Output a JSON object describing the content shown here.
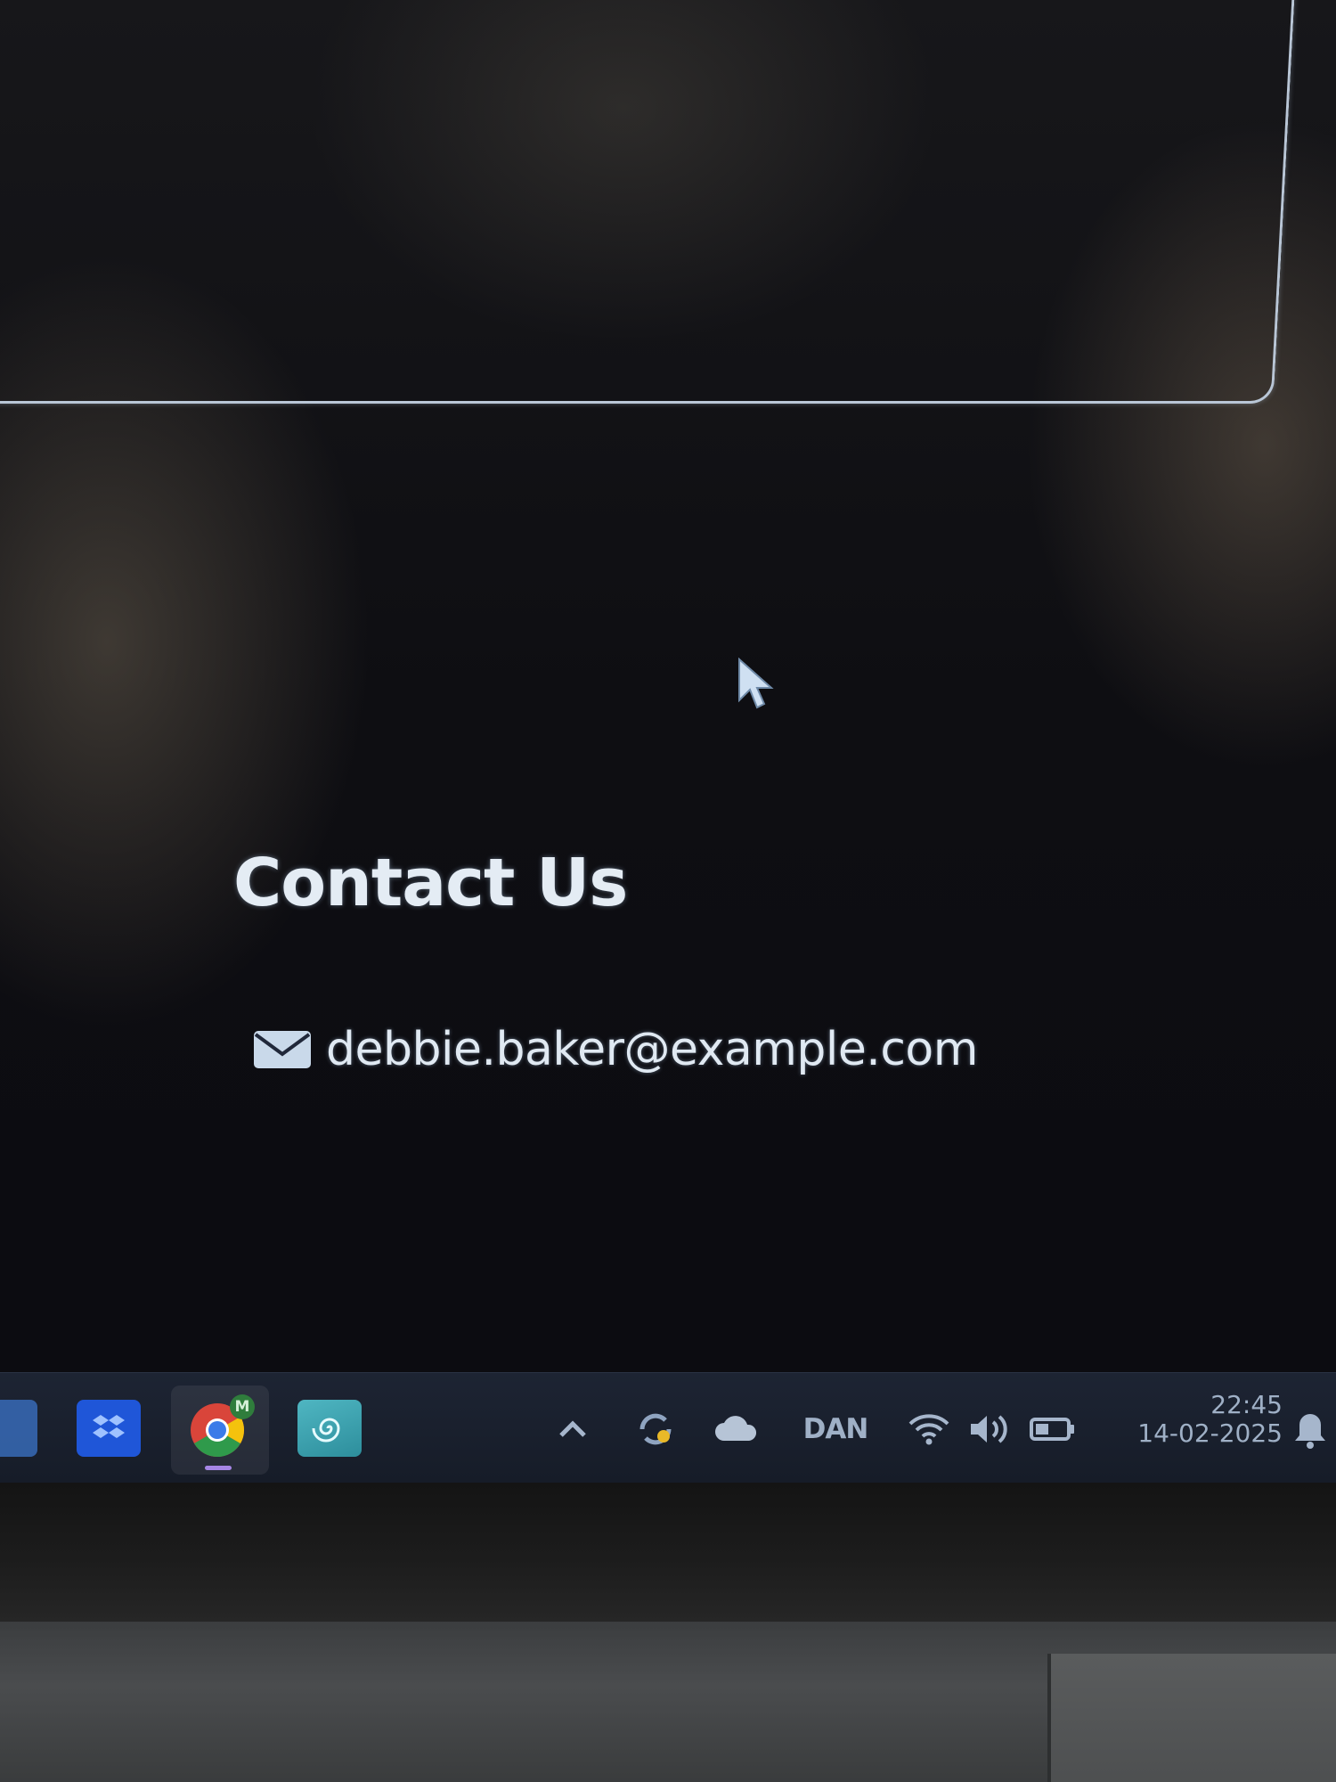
{
  "contact": {
    "heading": "Contact Us",
    "email": "debbie.baker@example.com",
    "email_icon": "envelope-icon"
  },
  "taskbar": {
    "pinned_apps": [
      {
        "name": "start",
        "icon": "windows-start-icon"
      },
      {
        "name": "dropbox",
        "icon": "dropbox-icon"
      },
      {
        "name": "chrome",
        "icon": "chrome-icon",
        "badge": "M"
      },
      {
        "name": "app",
        "icon": "swirl-app-icon"
      }
    ],
    "tray": {
      "language": "DAN",
      "icons": [
        "chevron-up-icon",
        "sync-icon",
        "cloud-icon",
        "wifi-icon",
        "volume-icon",
        "battery-icon",
        "notification-bell-icon"
      ]
    },
    "clock": {
      "time": "22:45",
      "date": "14-02-2025"
    }
  },
  "colors": {
    "heading_text": "#e4ecf4",
    "taskbar_bg": "#1d2433",
    "chrome_active_indicator": "#a686e6",
    "dropbox_blue": "#1f56d8"
  }
}
